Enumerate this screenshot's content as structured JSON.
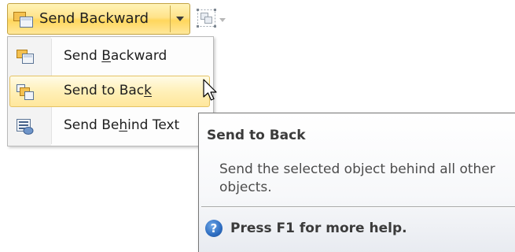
{
  "ribbon": {
    "split_button": {
      "label": "Send Backward",
      "icon": "send-backward-icon",
      "dropdown_icon": "chevron-down-icon"
    },
    "group_button": {
      "icon": "group-objects-icon",
      "dropdown_icon": "chevron-down-icon",
      "state": "disabled"
    }
  },
  "menu": {
    "items": [
      {
        "label_before": "Send ",
        "accelerator": "B",
        "label_after": "ackward",
        "icon": "send-backward-icon",
        "selected": false
      },
      {
        "label_before": "Send to Bac",
        "accelerator": "k",
        "label_after": "",
        "icon": "send-to-back-icon",
        "selected": true
      },
      {
        "label_before": "Send Be",
        "accelerator": "h",
        "label_after": "ind Text",
        "icon": "send-behind-text-icon",
        "selected": false
      }
    ]
  },
  "tooltip": {
    "title": "Send to Back",
    "description": "Send the selected object behind all other objects.",
    "help_text": "Press F1 for more help.",
    "help_icon": "help-icon"
  },
  "colors": {
    "highlight_top": "#fff3b7",
    "highlight_bottom": "#ffd65c",
    "highlight_border": "#c2a243",
    "help_icon_blue": "#2d6cc0"
  }
}
